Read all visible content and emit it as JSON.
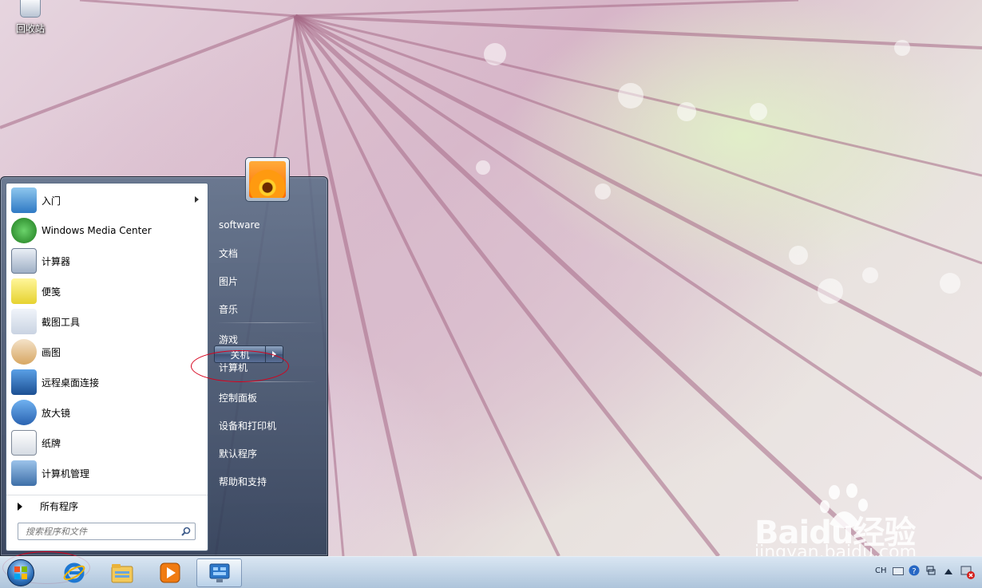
{
  "desktop": {
    "recycle_bin_label": "回收站"
  },
  "start_menu": {
    "programs": [
      {
        "label": "入门",
        "icon": "getting-started-icon",
        "has_submenu": true
      },
      {
        "label": "Windows Media Center",
        "icon": "windows-media-center-icon",
        "has_submenu": false
      },
      {
        "label": "计算器",
        "icon": "calculator-icon",
        "has_submenu": false
      },
      {
        "label": "便笺",
        "icon": "sticky-notes-icon",
        "has_submenu": false
      },
      {
        "label": "截图工具",
        "icon": "snipping-tool-icon",
        "has_submenu": false
      },
      {
        "label": "画图",
        "icon": "paint-icon",
        "has_submenu": false
      },
      {
        "label": "远程桌面连接",
        "icon": "remote-desktop-icon",
        "has_submenu": false
      },
      {
        "label": "放大镜",
        "icon": "magnifier-icon",
        "has_submenu": false
      },
      {
        "label": "纸牌",
        "icon": "solitaire-icon",
        "has_submenu": false
      },
      {
        "label": "计算机管理",
        "icon": "computer-management-icon",
        "has_submenu": false
      }
    ],
    "all_programs_label": "所有程序",
    "search_placeholder": "搜索程序和文件",
    "right_links": [
      {
        "label": "software"
      },
      {
        "label": "文档"
      },
      {
        "label": "图片"
      },
      {
        "label": "音乐"
      },
      {
        "label": "游戏"
      },
      {
        "label": "计算机"
      },
      {
        "label": "控制面板"
      },
      {
        "label": "设备和打印机"
      },
      {
        "label": "默认程序"
      },
      {
        "label": "帮助和支持"
      }
    ],
    "shutdown_label": "关机"
  },
  "taskbar": {
    "pinned": [
      "internet-explorer-icon",
      "windows-explorer-icon",
      "media-player-icon",
      "control-panel-icon"
    ],
    "tray": {
      "language": "CH"
    }
  },
  "watermark": {
    "brand": "Baidu经验",
    "url": "jingyan.baidu.com"
  },
  "colors": {
    "annotation": "#d6001c",
    "menu_frame": "#3b4d6a"
  }
}
